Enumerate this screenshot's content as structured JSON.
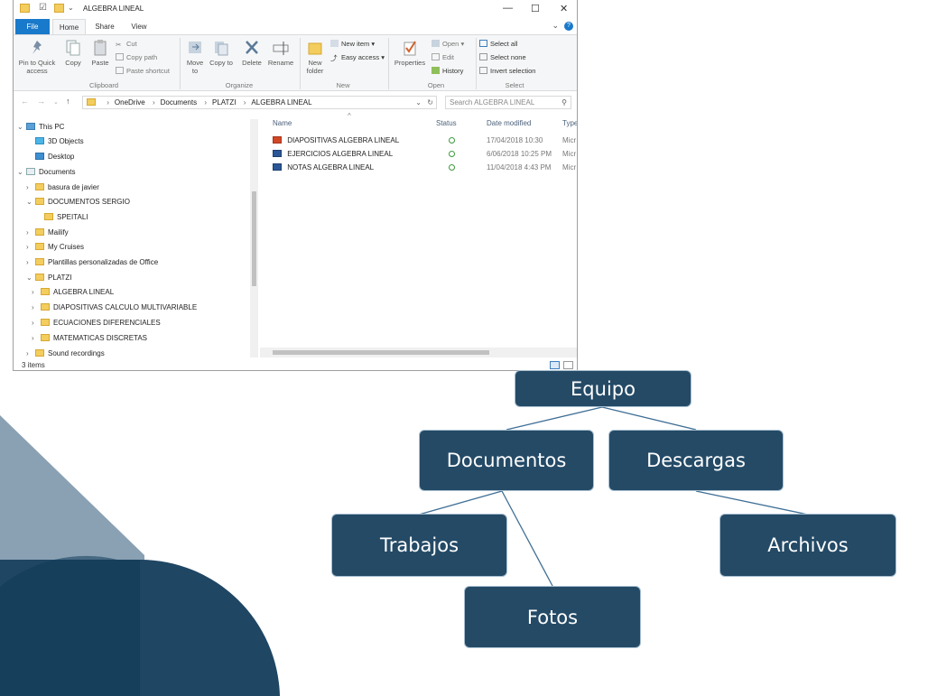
{
  "window": {
    "title": "ALGEBRA LINEAL",
    "controls": {
      "minimize": "—",
      "maximize": "☐",
      "close": "✕"
    }
  },
  "menu": {
    "file": "File",
    "tabs": [
      "Home",
      "Share",
      "View"
    ]
  },
  "ribbon": {
    "clipboard": {
      "pin": "Pin to Quick access",
      "copy": "Copy",
      "paste": "Paste",
      "cut": "Cut",
      "copy_path": "Copy path",
      "paste_shortcut": "Paste shortcut",
      "group": "Clipboard"
    },
    "organize": {
      "move_to": "Move to",
      "copy_to": "Copy to",
      "delete": "Delete",
      "rename": "Rename",
      "group": "Organize"
    },
    "new": {
      "new_folder": "New folder",
      "new_item": "New item",
      "easy_access": "Easy access",
      "group": "New"
    },
    "open": {
      "properties": "Properties",
      "open": "Open",
      "edit": "Edit",
      "history": "History",
      "group": "Open"
    },
    "select": {
      "select_all": "Select all",
      "select_none": "Select none",
      "invert": "Invert selection",
      "group": "Select"
    }
  },
  "address": {
    "path": [
      "OneDrive",
      "Documents",
      "PLATZI",
      "ALGEBRA LINEAL"
    ],
    "search_placeholder": "Search ALGEBRA LINEAL"
  },
  "tree": [
    {
      "label": "This PC",
      "arrow": "v",
      "icon": "pc"
    },
    {
      "label": "3D Objects",
      "arrow": "",
      "icon": "cube"
    },
    {
      "label": "Desktop",
      "arrow": "",
      "icon": "desktop"
    },
    {
      "label": "Documents",
      "arrow": "v",
      "icon": "docs"
    },
    {
      "label": "basura de javier",
      "arrow": ">",
      "icon": "folder"
    },
    {
      "label": "DOCUMENTOS SERGIO",
      "arrow": "v",
      "icon": "folder"
    },
    {
      "label": "SPEITALI",
      "arrow": "",
      "icon": "folder"
    },
    {
      "label": "Mailify",
      "arrow": ">",
      "icon": "folder"
    },
    {
      "label": "My Cruises",
      "arrow": ">",
      "icon": "folder"
    },
    {
      "label": "Plantillas personalizadas de Office",
      "arrow": ">",
      "icon": "folder"
    },
    {
      "label": "PLATZI",
      "arrow": "v",
      "icon": "folder"
    },
    {
      "label": "ALGEBRA LINEAL",
      "arrow": ">",
      "icon": "folder"
    },
    {
      "label": "DIAPOSITIVAS CALCULO MULTIVARIABLE",
      "arrow": ">",
      "icon": "folder"
    },
    {
      "label": "ECUACIONES DIFERENCIALES",
      "arrow": ">",
      "icon": "folder"
    },
    {
      "label": "MATEMATICAS DISCRETAS",
      "arrow": ">",
      "icon": "folder"
    },
    {
      "label": "Sound recordings",
      "arrow": ">",
      "icon": "folder"
    }
  ],
  "columns": {
    "name": "Name",
    "status": "Status",
    "date": "Date modified",
    "type": "Type"
  },
  "files": [
    {
      "name": "DIAPOSITIVAS ALGEBRA LINEAL",
      "kind": "ppt",
      "date": "17/04/2018 10:30",
      "type": "Micr"
    },
    {
      "name": "EJERCICIOS ALGEBRA LINEAL",
      "kind": "word",
      "date": "6/06/2018 10:25 PM",
      "type": "Micr"
    },
    {
      "name": "NOTAS ALGEBRA LINEAL",
      "kind": "word",
      "date": "11/04/2018 4:43 PM",
      "type": "Micr"
    }
  ],
  "status": {
    "count": "3 items"
  },
  "org_chart": {
    "root": "Equipo",
    "documentos": "Documentos",
    "descargas": "Descargas",
    "trabajos": "Trabajos",
    "fotos": "Fotos",
    "archivos": "Archivos"
  },
  "colors": {
    "node": "#244a66",
    "accent": "#1979ca",
    "deco_dark": "#1f4663",
    "deco_light": "#8aa1b4"
  }
}
